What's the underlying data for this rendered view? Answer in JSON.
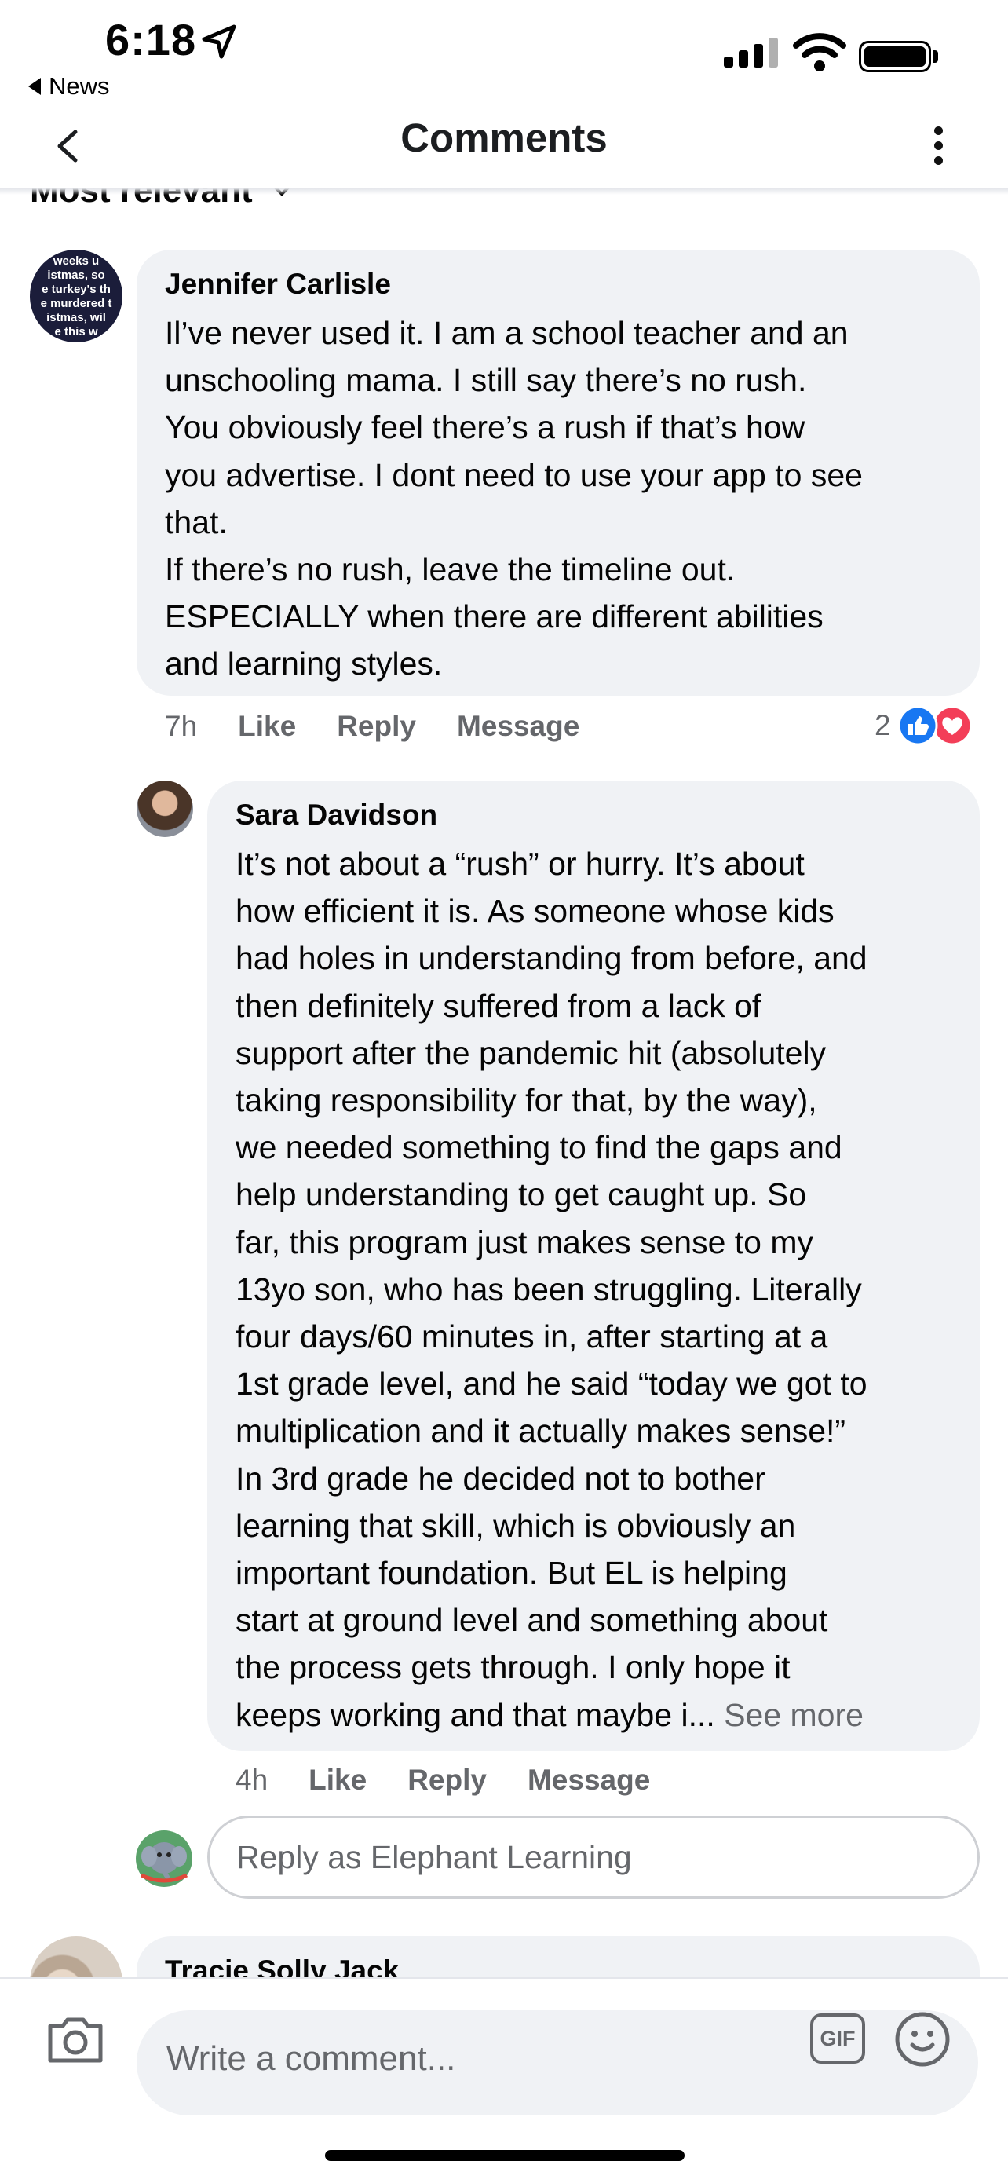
{
  "status_bar": {
    "time": "6:18",
    "back_app": "News"
  },
  "header": {
    "title": "Comments",
    "sort_label": "Most relevant"
  },
  "comments": [
    {
      "author": "Jennifer Carlisle",
      "text": "Il’ve never used it. I am a school teacher and an\nunschooling mama. I still say there’s no rush.\nYou obviously feel there’s a rush if that’s how\nyou advertise. I dont need to use your app to see\nthat.\nIf there’s no rush, leave the timeline out.\nESPECIALLY when there are different abilities\nand learning styles.",
      "time": "7h",
      "actions": {
        "like": "Like",
        "reply": "Reply",
        "message": "Message"
      },
      "reaction_count": "2",
      "reactions": [
        "like-icon",
        "love-icon"
      ]
    },
    {
      "author": "Sara Davidson",
      "text": "It’s not about a “rush” or hurry.  It’s about\nhow efficient it is.  As someone whose kids\nhad holes in understanding from before, and\nthen definitely suffered from a lack of\nsupport after the pandemic hit (absolutely\ntaking responsibility for that, by the way),\nwe needed something to find the gaps and\nhelp understanding to get caught up.  So\nfar, this program just makes sense to my\n13yo son, who has been struggling.  Literally\nfour days/60 minutes in, after starting at a\n1st grade level, and he said “today we got to\nmultiplication and it actually makes sense!”\nIn 3rd grade he decided not to bother\nlearning that skill, which is obviously an\nimportant foundation.  But EL is helping\nstart at ground level and something about\nthe process gets through.  I only hope it\nkeeps working and that maybe i...",
      "see_more": "See more",
      "time": "4h",
      "actions": {
        "like": "Like",
        "reply": "Reply",
        "message": "Message"
      }
    },
    {
      "author": "Tracie Solly Jack"
    }
  ],
  "avatar1_text": "weeks u\nistmas, so\ne turkey's th\ne murdered t\nistmas, wil\ne this w",
  "reply_box": {
    "placeholder": "Reply as Elephant Learning"
  },
  "composer": {
    "placeholder": "Write a comment...",
    "gif_label": "GIF"
  },
  "colors": {
    "like_blue": "#1877f2",
    "love_red": "#f33e58",
    "bubble": "#f0f2f5",
    "muted": "#65676b"
  }
}
